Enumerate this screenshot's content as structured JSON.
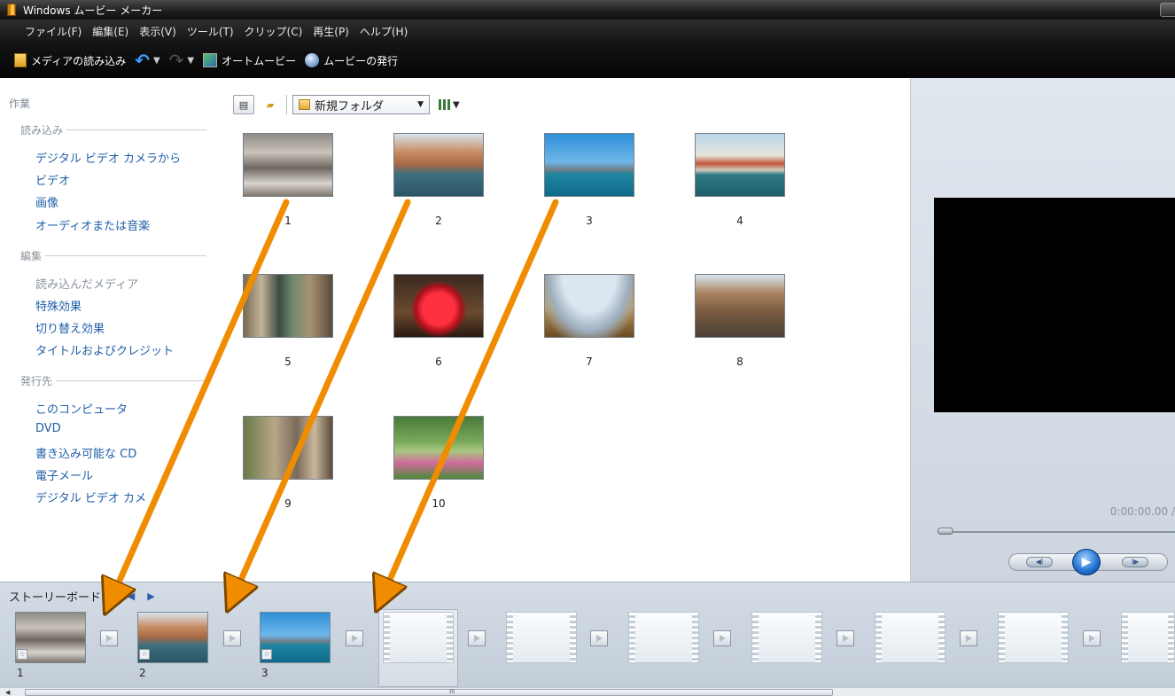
{
  "window": {
    "title": "Windows ムービー メーカー"
  },
  "menu": [
    "ファイル(F)",
    "編集(E)",
    "表示(V)",
    "ツール(T)",
    "クリップ(C)",
    "再生(P)",
    "ヘルプ(H)"
  ],
  "toolbar": {
    "import_label": "メディアの読み込み",
    "automovie_label": "オートムービー",
    "publish_label": "ムービーの発行"
  },
  "tasks": {
    "title": "作業",
    "sections": [
      {
        "label": "読み込み",
        "items": [
          "デジタル ビデオ カメラから",
          "ビデオ",
          "画像",
          "オーディオまたは音楽"
        ]
      },
      {
        "label": "編集",
        "items": [
          "読み込んだメディア",
          "特殊効果",
          "切り替え効果",
          "タイトルおよびクレジット"
        ]
      },
      {
        "label": "発行先",
        "items": [
          "このコンピュータ",
          "DVD",
          "書き込み可能な CD",
          "電子メール",
          "デジタル ビデオ カメ"
        ]
      }
    ]
  },
  "collection": {
    "folder": "新規フォルダ",
    "clips": [
      "1",
      "2",
      "3",
      "4",
      "5",
      "6",
      "7",
      "8",
      "9",
      "10"
    ]
  },
  "preview": {
    "timecode": "0:00:00.00 /"
  },
  "storyboard": {
    "label": "ストーリーボード",
    "items": [
      "1",
      "2",
      "3"
    ]
  },
  "scrollbar": {
    "grip": "III"
  },
  "colors": {
    "arrow": "#F08C00",
    "link": "#1f5fa8"
  }
}
